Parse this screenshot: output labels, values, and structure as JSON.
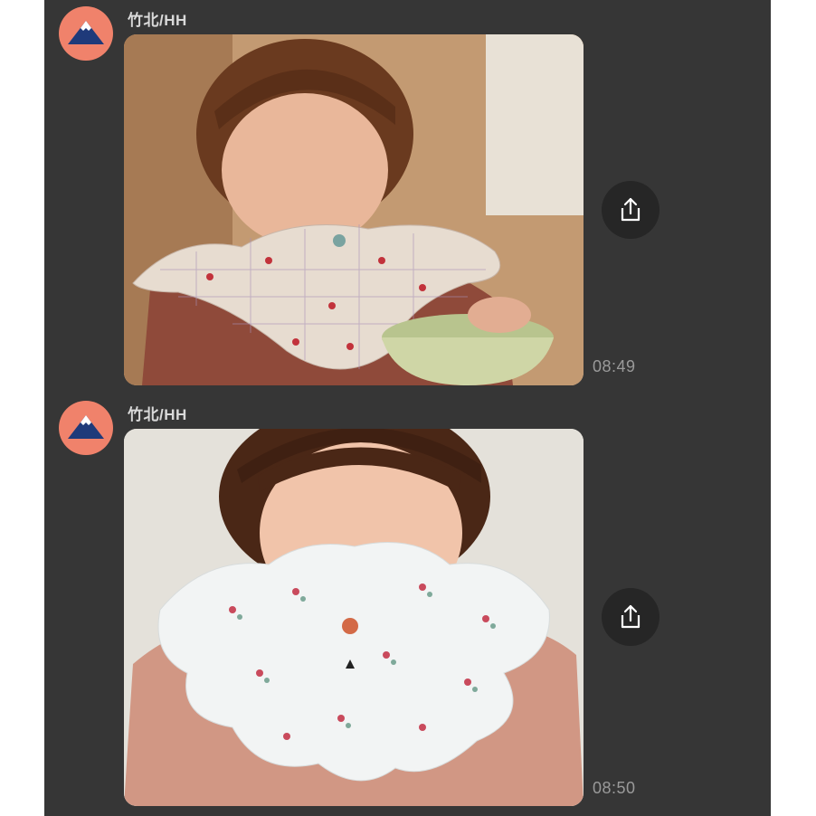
{
  "messages": [
    {
      "sender": "竹北/HH",
      "avatar_icon": "mountain-icon",
      "image_alt": "toddler wearing a plaid scalloped bib holding a green bowl",
      "time": "08:49",
      "action_icon": "share-icon"
    },
    {
      "sender": "竹北/HH",
      "avatar_icon": "mountain-icon",
      "image_alt": "toddler wearing a white floral scalloped bib",
      "time": "08:50",
      "action_icon": "share-icon"
    }
  ],
  "colors": {
    "chat_background": "#363636",
    "avatar_background": "#f0826b",
    "share_button": "#262626",
    "sender_text": "#d9d9d9",
    "time_text": "#9a9a9a"
  }
}
